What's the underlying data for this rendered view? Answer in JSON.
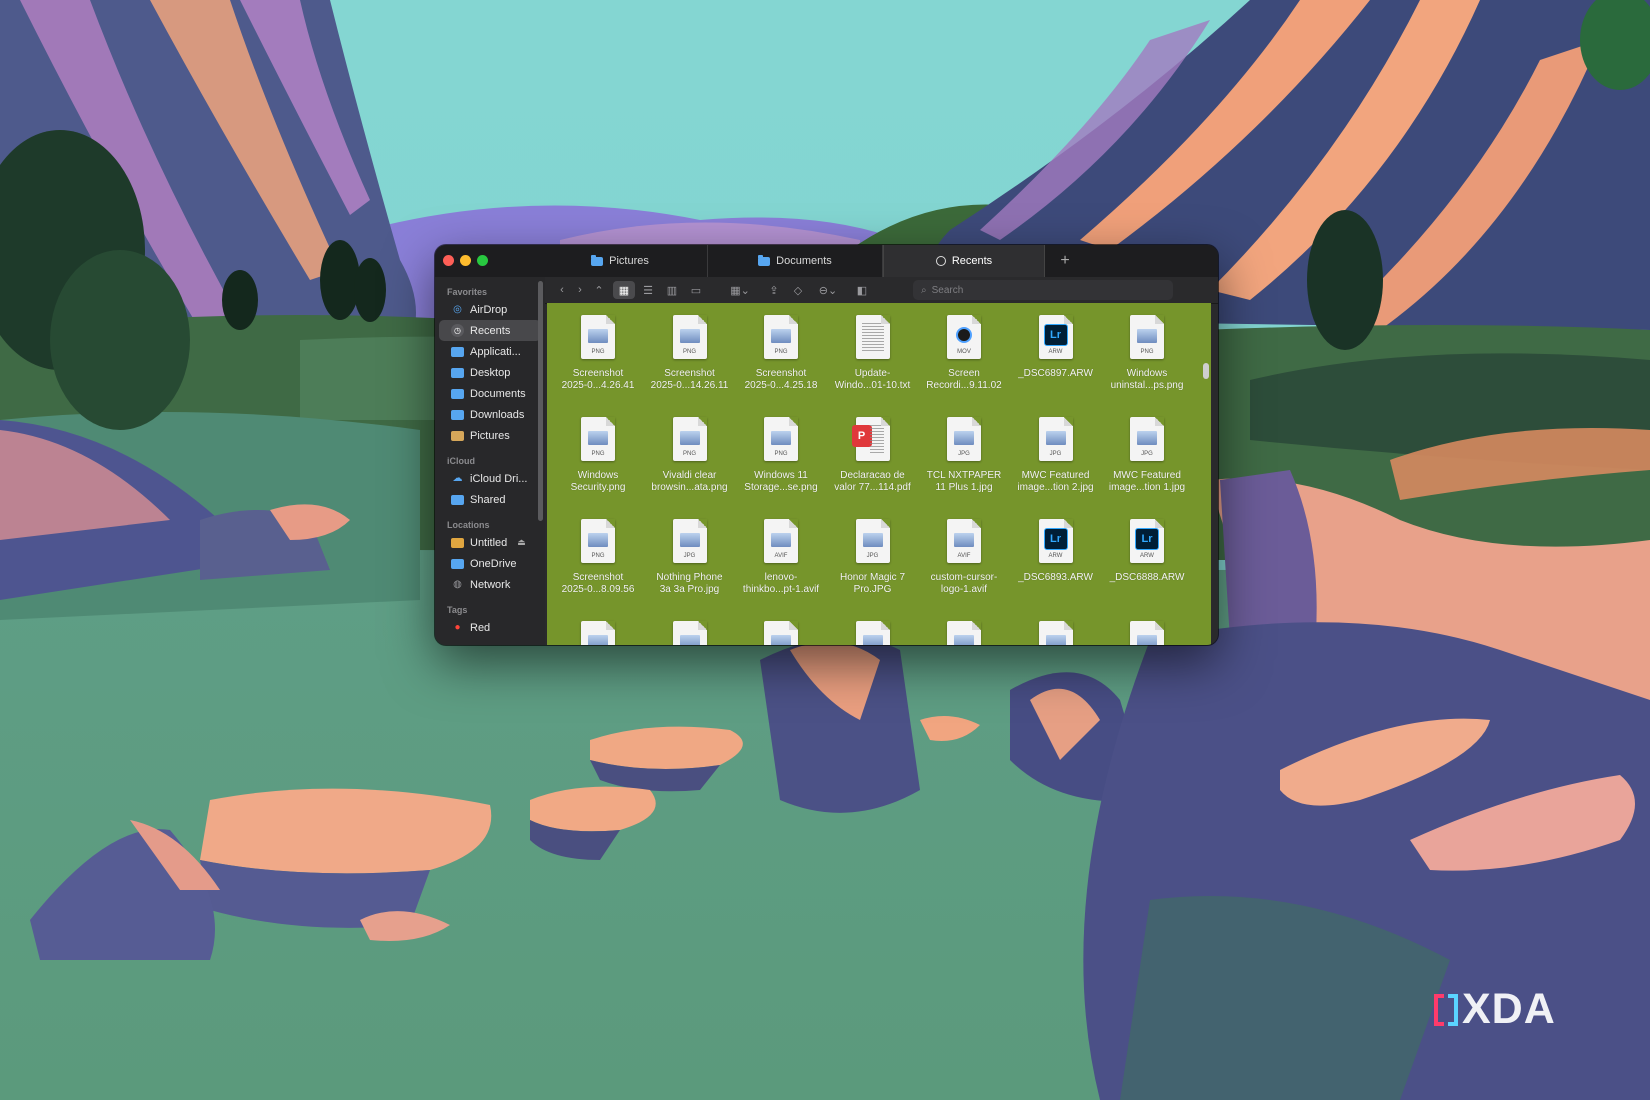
{
  "window": {
    "tabs": [
      {
        "label": "Pictures",
        "icon": "folder-icon"
      },
      {
        "label": "Documents",
        "icon": "folder-icon"
      },
      {
        "label": "Recents",
        "icon": "clock-icon",
        "active": true
      }
    ],
    "new_tab": "+"
  },
  "sidebar": {
    "sections": [
      {
        "title": "Favorites",
        "items": [
          {
            "label": "AirDrop",
            "icon": "airdrop-icon"
          },
          {
            "label": "Recents",
            "icon": "clock-icon",
            "selected": true
          },
          {
            "label": "Applicati...",
            "icon": "folder-icon"
          },
          {
            "label": "Desktop",
            "icon": "folder-icon"
          },
          {
            "label": "Documents",
            "icon": "folder-icon"
          },
          {
            "label": "Downloads",
            "icon": "folder-icon"
          },
          {
            "label": "Pictures",
            "icon": "pictures-folder-icon"
          }
        ]
      },
      {
        "title": "iCloud",
        "items": [
          {
            "label": "iCloud Dri...",
            "icon": "cloud-icon"
          },
          {
            "label": "Shared",
            "icon": "shared-icon"
          }
        ]
      },
      {
        "title": "Locations",
        "items": [
          {
            "label": "Untitled",
            "icon": "drive-icon",
            "eject": "⏏"
          },
          {
            "label": "OneDrive",
            "icon": "folder-icon"
          },
          {
            "label": "Network",
            "icon": "globe-icon"
          }
        ]
      },
      {
        "title": "Tags",
        "items": [
          {
            "label": "Red",
            "icon": "red-tag-icon"
          }
        ]
      }
    ]
  },
  "toolbar": {
    "search_placeholder": "Search"
  },
  "files": [
    {
      "line1": "Screenshot",
      "line2": "2025-0...4.26.41",
      "kind": "image",
      "ext": "PNG"
    },
    {
      "line1": "Screenshot",
      "line2": "2025-0...14.26.11",
      "kind": "image",
      "ext": "PNG"
    },
    {
      "line1": "Screenshot",
      "line2": "2025-0...4.25.18",
      "kind": "image",
      "ext": "PNG"
    },
    {
      "line1": "Update-",
      "line2": "Windo...01-10.txt",
      "kind": "text",
      "ext": ""
    },
    {
      "line1": "Screen",
      "line2": "Recordi...9.11.02",
      "kind": "movie",
      "ext": "MOV"
    },
    {
      "line1": "_DSC6897.ARW",
      "line2": "",
      "kind": "lightroom",
      "ext": "ARW"
    },
    {
      "line1": "Windows",
      "line2": "uninstal...ps.png",
      "kind": "image",
      "ext": "PNG"
    },
    {
      "line1": "Windows",
      "line2": "Security.png",
      "kind": "image",
      "ext": "PNG"
    },
    {
      "line1": "Vivaldi clear",
      "line2": "browsin...ata.png",
      "kind": "image",
      "ext": "PNG"
    },
    {
      "line1": "Windows 11",
      "line2": "Storage...se.png",
      "kind": "image",
      "ext": "PNG"
    },
    {
      "line1": "Declaracao de",
      "line2": "valor 77...114.pdf",
      "kind": "pdf",
      "ext": ""
    },
    {
      "line1": "TCL NXTPAPER",
      "line2": "11 Plus 1.jpg",
      "kind": "image",
      "ext": "JPG"
    },
    {
      "line1": "MWC Featured",
      "line2": "image...tion 2.jpg",
      "kind": "image",
      "ext": "JPG"
    },
    {
      "line1": "MWC Featured",
      "line2": "image...tion 1.jpg",
      "kind": "image",
      "ext": "JPG"
    },
    {
      "line1": "Screenshot",
      "line2": "2025-0...8.09.56",
      "kind": "image",
      "ext": "PNG"
    },
    {
      "line1": "Nothing Phone",
      "line2": "3a 3a Pro.jpg",
      "kind": "image",
      "ext": "JPG"
    },
    {
      "line1": "lenovo-",
      "line2": "thinkbo...pt-1.avif",
      "kind": "image",
      "ext": "AVIF"
    },
    {
      "line1": "Honor Magic 7",
      "line2": "Pro.JPG",
      "kind": "image",
      "ext": "JPG"
    },
    {
      "line1": "custom-cursor-",
      "line2": "logo-1.avif",
      "kind": "image",
      "ext": "AVIF"
    },
    {
      "line1": "_DSC6893.ARW",
      "line2": "",
      "kind": "lightroom",
      "ext": "ARW"
    },
    {
      "line1": "_DSC6888.ARW",
      "line2": "",
      "kind": "lightroom",
      "ext": "ARW"
    },
    {
      "line1": "",
      "line2": "",
      "kind": "image",
      "ext": ""
    },
    {
      "line1": "",
      "line2": "",
      "kind": "image",
      "ext": ""
    },
    {
      "line1": "",
      "line2": "",
      "kind": "image",
      "ext": ""
    },
    {
      "line1": "",
      "line2": "",
      "kind": "image",
      "ext": ""
    },
    {
      "line1": "",
      "line2": "",
      "kind": "image",
      "ext": ""
    },
    {
      "line1": "",
      "line2": "",
      "kind": "image",
      "ext": ""
    },
    {
      "line1": "",
      "line2": "",
      "kind": "image",
      "ext": ""
    }
  ],
  "watermark": {
    "text": "XDA"
  },
  "colors": {
    "content_background": "#76952b",
    "accent": "#57a6f0"
  }
}
